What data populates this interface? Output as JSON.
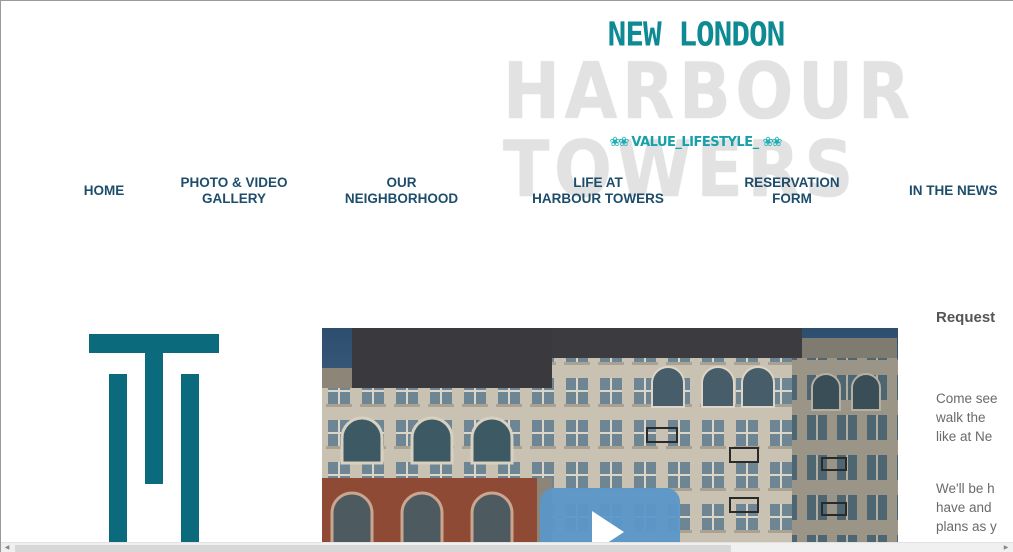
{
  "logo": {
    "line1": "NEW LONDON",
    "line2": "HARBOUR TOWERS",
    "tagline": "VALUE_LIFESTYLE_",
    "deco": "❀❀"
  },
  "nav": {
    "items": [
      {
        "line1": "HOME",
        "line2": ""
      },
      {
        "line1": "PHOTO & VIDEO",
        "line2": "GALLERY"
      },
      {
        "line1": "OUR",
        "line2": "NEIGHBORHOOD"
      },
      {
        "line1": "LIFE AT",
        "line2": "HARBOUR TOWERS"
      },
      {
        "line1": "RESERVATION",
        "line2": "FORM"
      },
      {
        "line1": "IN THE NEWS",
        "line2": ""
      }
    ]
  },
  "side": {
    "heading": "Request",
    "p1": [
      "Come see",
      "walk the",
      "like at Ne"
    ],
    "p2": [
      "We'll be h",
      "have and",
      "plans as y"
    ]
  },
  "colors": {
    "nav_text": "#1e4d6b",
    "brand_teal": "#0b6a7b",
    "play_button": "#5b97c9"
  }
}
